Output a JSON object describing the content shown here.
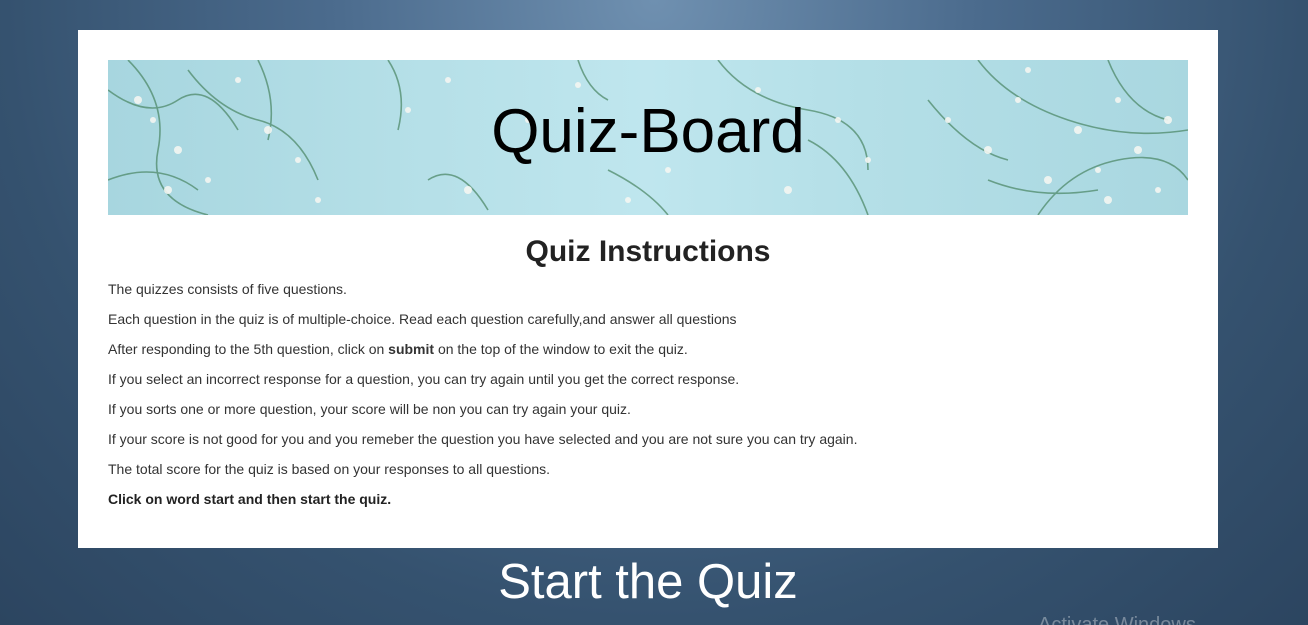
{
  "banner": {
    "title": "Quiz-Board"
  },
  "instructions": {
    "heading": "Quiz Instructions",
    "lines": [
      "The quizzes consists of five questions.",
      "Each question in the quiz is of multiple-choice. Read each question carefully,and answer all questions",
      "If you select an incorrect response for a question, you can try again until you get the correct response.",
      "If you sorts one or more question, your score will be non you can try again your quiz.",
      "If your score is not good for you and you remeber the question you have selected and you are not sure you can try again.",
      "The total score for the quiz is based on your responses to all questions.",
      "Click on word start and then start the quiz."
    ],
    "submit_line": {
      "before": "After responding to the 5th question, click on ",
      "bold": "submit",
      "after": " on the top of the window to exit the quiz."
    }
  },
  "start_label": "Start the Quiz",
  "watermark": "Activate Windows",
  "colors": {
    "page_background": "#4b6b8d",
    "card": "#ffffff",
    "banner": "#b6e0e8"
  }
}
